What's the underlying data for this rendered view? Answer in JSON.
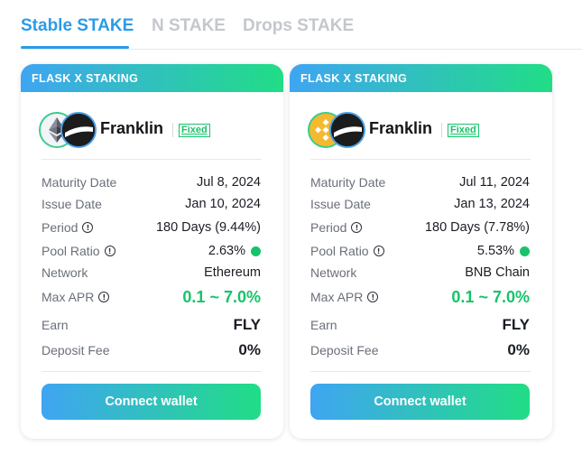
{
  "tabs": [
    {
      "label": "Stable STAKE",
      "active": true
    },
    {
      "label": "N STAKE",
      "active": false
    },
    {
      "label": "Drops STAKE",
      "active": false
    }
  ],
  "colors": {
    "accent_blue": "#2b9be8",
    "gradient_start": "#3fa5f2",
    "gradient_end": "#21dd86",
    "green": "#16c36a"
  },
  "cards": [
    {
      "header": "FLASK X STAKING",
      "coin_a_icon": "ethereum-icon",
      "coin_b_icon": "franklin-icon",
      "name": "Franklin",
      "badge": "Fixed",
      "labels": {
        "maturity": "Maturity Date",
        "issue": "Issue Date",
        "period": "Period",
        "pool": "Pool Ratio",
        "network": "Network",
        "apr": "Max APR",
        "earn": "Earn",
        "fee": "Deposit Fee"
      },
      "values": {
        "maturity": "Jul 8, 2024",
        "issue": "Jan 10, 2024",
        "period": "180 Days (9.44%)",
        "pool": "2.63%",
        "network": "Ethereum",
        "apr": "0.1 ~ 7.0%",
        "earn": "FLY",
        "fee": "0%"
      },
      "button": "Connect wallet"
    },
    {
      "header": "FLASK X STAKING",
      "coin_a_icon": "bnb-icon",
      "coin_b_icon": "franklin-icon",
      "name": "Franklin",
      "badge": "Fixed",
      "labels": {
        "maturity": "Maturity Date",
        "issue": "Issue Date",
        "period": "Period",
        "pool": "Pool Ratio",
        "network": "Network",
        "apr": "Max APR",
        "earn": "Earn",
        "fee": "Deposit Fee"
      },
      "values": {
        "maturity": "Jul 11, 2024",
        "issue": "Jan 13, 2024",
        "period": "180 Days (7.78%)",
        "pool": "5.53%",
        "network": "BNB Chain",
        "apr": "0.1 ~ 7.0%",
        "earn": "FLY",
        "fee": "0%"
      },
      "button": "Connect wallet"
    }
  ]
}
